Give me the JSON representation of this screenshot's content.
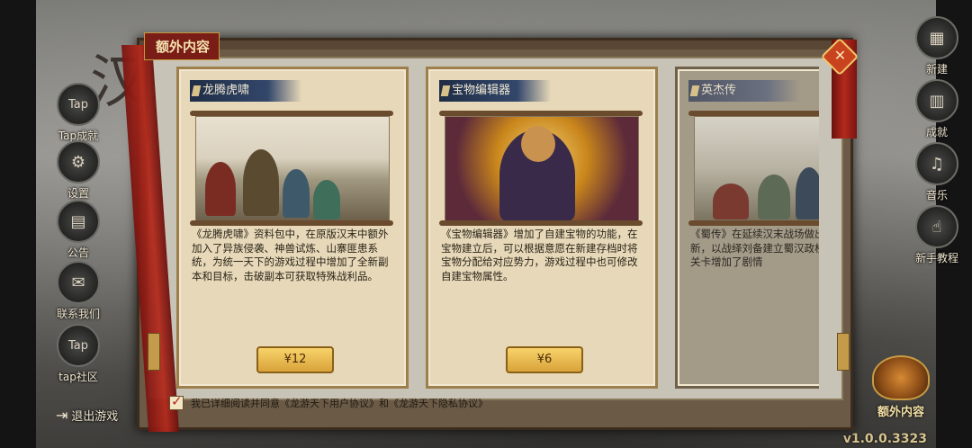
{
  "window": {
    "version": "v1.0.0.3323",
    "bg_char": "汉"
  },
  "left_menu": [
    {
      "label": "Tap成就",
      "icon_text": "Tap",
      "icon": "tap-icon"
    },
    {
      "label": "设置",
      "icon_text": "⚙",
      "icon": "gear-icon"
    },
    {
      "label": "公告",
      "icon_text": "▤",
      "icon": "notice-icon"
    },
    {
      "label": "联系我们",
      "icon_text": "✉",
      "icon": "mail-icon"
    },
    {
      "label": "tap社区",
      "icon_text": "Tap",
      "icon": "tap-community-icon"
    }
  ],
  "exit_label": "退出游戏",
  "right_menu": [
    {
      "label": "新建",
      "icon_text": "▦",
      "icon": "new-icon"
    },
    {
      "label": "成就",
      "icon_text": "▥",
      "icon": "achievement-icon"
    },
    {
      "label": "音乐",
      "icon_text": "♫",
      "icon": "music-icon"
    },
    {
      "label": "新手教程",
      "icon_text": "☝",
      "icon": "tutorial-icon"
    }
  ],
  "extra_badge_label": "额外内容",
  "modal": {
    "title": "额外内容",
    "cards": [
      {
        "title": "龙腾虎啸",
        "description": "《龙腾虎啸》资料包中，在原版汉末中额外加入了异族侵袭、神兽试炼、山寨匪患系统，为统一天下的游戏过程中增加了全新副本和目标，击破副本可获取特殊战利品。",
        "price": "¥12"
      },
      {
        "title": "宝物编辑器",
        "description": "《宝物编辑器》增加了自建宝物的功能，在宝物建立后，可以根据意愿在新建存档时将宝物分配给对应势力，游戏过程中也可修改自建宝物属性。",
        "price": "¥6"
      },
      {
        "title": "英杰传",
        "description": "《蜀传》在延续汉末战场做出了一定的创新，以战绎刘备建立蜀汉政权之路绎，配合关卡增加了剧情"
      }
    ],
    "agreement": "我已详细阅读并同意《龙游天下用户协议》和《龙游天下隐私协议》"
  }
}
